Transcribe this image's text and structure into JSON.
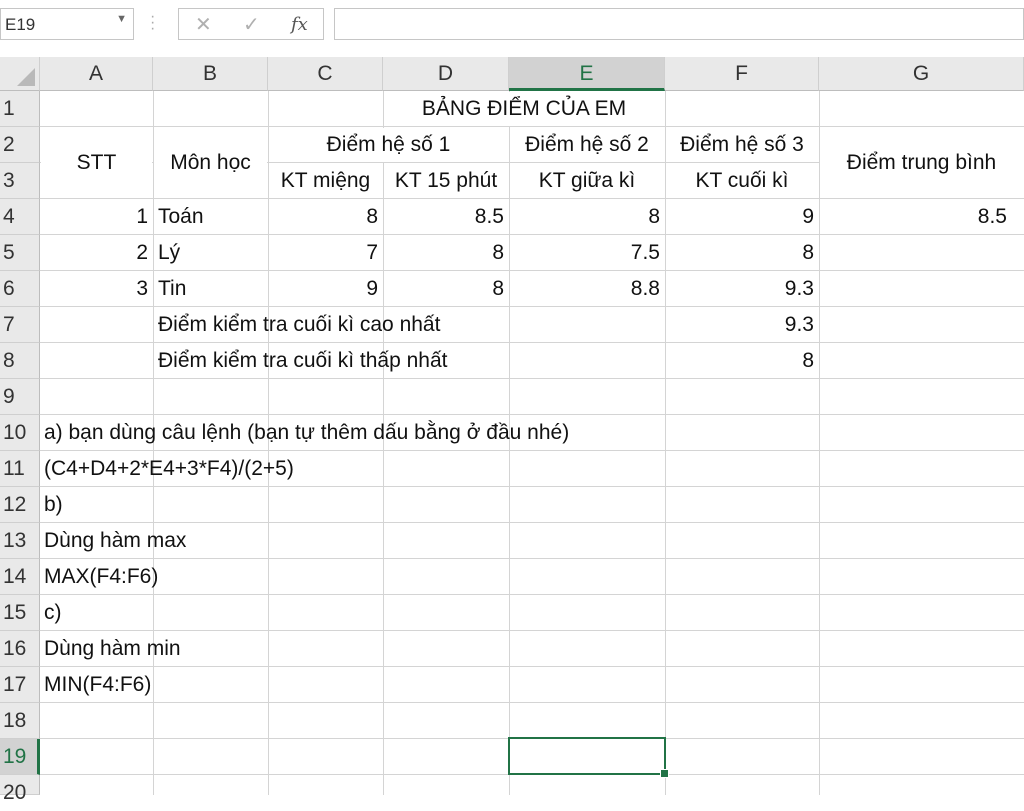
{
  "formula_bar": {
    "name_box": "E19",
    "cancel_icon": "✕",
    "enter_icon": "✓",
    "fx_label": "fx",
    "formula": ""
  },
  "columns": [
    "A",
    "B",
    "C",
    "D",
    "E",
    "F",
    "G"
  ],
  "rows": [
    "1",
    "2",
    "3",
    "4",
    "5",
    "6",
    "7",
    "8",
    "9",
    "10",
    "11",
    "12",
    "13",
    "14",
    "15",
    "16",
    "17",
    "18",
    "19",
    "20"
  ],
  "selected_cell": "E19",
  "sheet": {
    "title": "BẢNG ĐIỂM CỦA EM",
    "stt": "STT",
    "mon_hoc": "Môn học",
    "he_so_1": "Điểm hệ số 1",
    "he_so_2": "Điểm hệ số 2",
    "he_so_3": "Điểm hệ số 3",
    "diem_tb": "Điểm trung bình",
    "kt_mieng": "KT miệng",
    "kt_15": "KT 15 phút",
    "kt_giua": "KT giữa kì",
    "kt_cuoi": "KT cuối kì",
    "data": [
      {
        "stt": "1",
        "mon": "Toán",
        "c": "8",
        "d": "8.5",
        "e": "8",
        "f": "9",
        "g": "8.5"
      },
      {
        "stt": "2",
        "mon": "Lý",
        "c": "7",
        "d": "8",
        "e": "7.5",
        "f": "8",
        "g": ""
      },
      {
        "stt": "3",
        "mon": "Tin",
        "c": "9",
        "d": "8",
        "e": "8.8",
        "f": "9.3",
        "g": ""
      }
    ],
    "max_label": "Điểm kiểm tra cuối kì cao nhất",
    "max_value": "9.3",
    "min_label": "Điểm kiểm tra cuối kì thấp nhất",
    "min_value": "8",
    "notes": [
      "a) bạn dùng câu lệnh  (bạn tự thêm dấu bằng ở đầu nhé)",
      "(C4+D4+2*E4+3*F4)/(2+5)",
      "b)",
      "Dùng hàm max",
      "MAX(F4:F6)",
      "c)",
      "Dùng hàm min",
      "MIN(F4:F6)"
    ]
  }
}
